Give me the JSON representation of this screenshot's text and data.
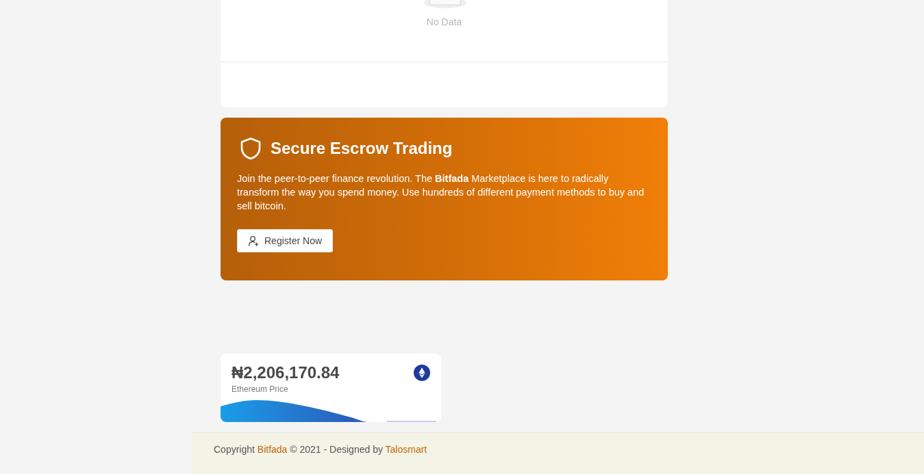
{
  "empty_state": {
    "text": "No Data"
  },
  "escrow_banner": {
    "title": "Secure Escrow Trading",
    "text": "Join the peer-to-peer finance revolution. The **Bitfada** Marketplace is here to radically transform the way you spend money. Use hundreds of different payment methods to buy and sell bitcoin.",
    "button": "Register Now"
  },
  "price_card": {
    "price": "₦2,206,170.84",
    "label": "Ethereum Price"
  },
  "footer": {
    "segments": [
      {
        "kind": "text",
        "text": "Copyright "
      },
      {
        "kind": "link",
        "text": "Bitfada"
      },
      {
        "kind": "text",
        "text": " © 2021 - Designed by "
      },
      {
        "kind": "link",
        "text": "Talosmart"
      }
    ]
  }
}
